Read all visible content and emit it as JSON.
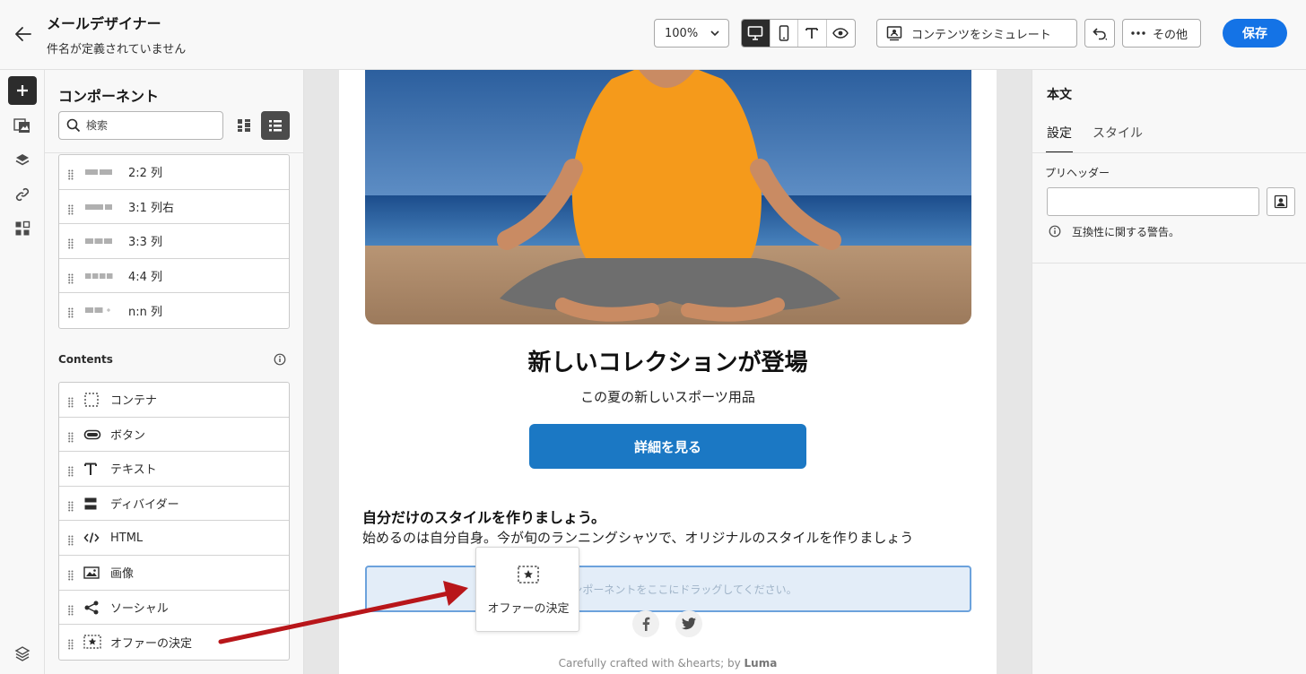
{
  "header": {
    "title": "メールデザイナー",
    "subtitle": "件名が定義されていません",
    "zoom": "100%",
    "simulate_label": "コンテンツをシミュレート",
    "more_label": "その他",
    "save_label": "保存"
  },
  "panel": {
    "title": "コンポーネント",
    "search_placeholder": "検索",
    "structures": [
      {
        "label": "2:2 列",
        "icon": "columns-2-2-icon"
      },
      {
        "label": "3:1 列右",
        "icon": "columns-3-1-icon"
      },
      {
        "label": "3:3 列",
        "icon": "columns-3-3-icon"
      },
      {
        "label": "4:4 列",
        "icon": "columns-4-4-icon"
      },
      {
        "label": "n:n 列",
        "icon": "columns-n-n-icon"
      }
    ],
    "contents_header": "Contents",
    "contents": [
      {
        "label": "コンテナ",
        "icon": "container-icon"
      },
      {
        "label": "ボタン",
        "icon": "button-icon"
      },
      {
        "label": "テキスト",
        "icon": "text-icon"
      },
      {
        "label": "ディバイダー",
        "icon": "divider-icon"
      },
      {
        "label": "HTML",
        "icon": "html-icon"
      },
      {
        "label": "画像",
        "icon": "image-icon"
      },
      {
        "label": "ソーシャル",
        "icon": "social-icon"
      },
      {
        "label": "オファーの決定",
        "icon": "offer-decision-icon"
      }
    ]
  },
  "email": {
    "title": "新しいコレクションが登場",
    "subtitle": "この夏の新しいスポーツ用品",
    "cta": "詳細を見る",
    "section_title": "自分だけのスタイルを作りましょう。",
    "section_body": "始めるのは自分自身。今が旬のランニングシャツで、オリジナルのスタイルを作りましょう",
    "dropzone": "新規コンポーネントをここにドラッグしてください。",
    "footer_prefix": "Carefully crafted with &hearts; by ",
    "footer_brand": "Luma"
  },
  "drag_card": {
    "label": "オファーの決定",
    "icon": "offer-decision-icon"
  },
  "right": {
    "title": "本文",
    "tabs": [
      "設定",
      "スタイル"
    ],
    "preheader_label": "プリヘッダー",
    "preheader_value": "",
    "compat_warning": "互換性に関する警告。"
  },
  "colors": {
    "accent": "#1473e6",
    "cta": "#1b78c4",
    "arrow": "#c0171a",
    "dropzone_border": "#6ca2dc"
  }
}
